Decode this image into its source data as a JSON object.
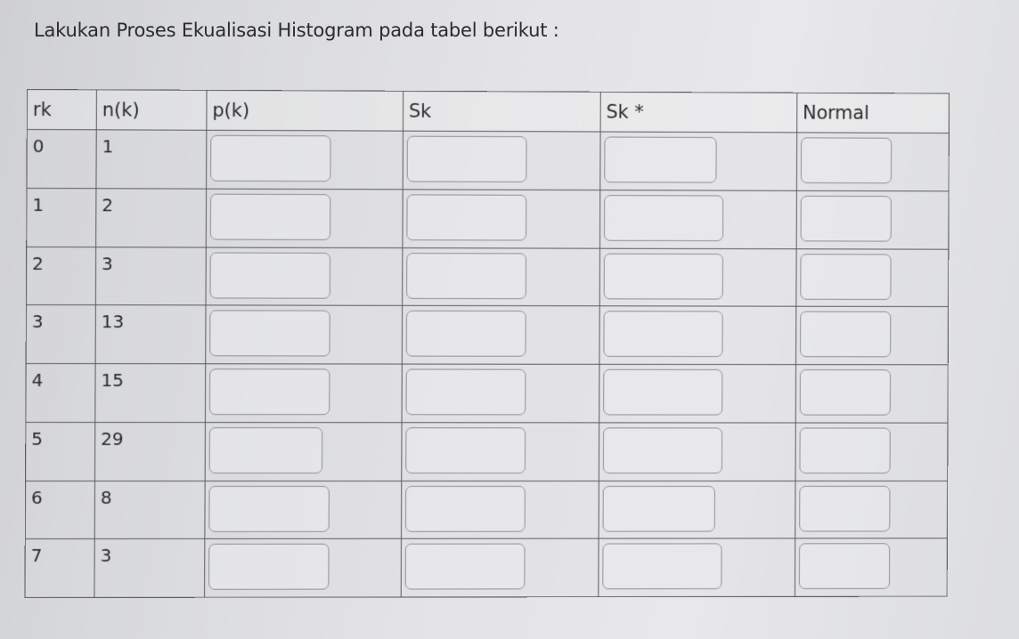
{
  "instruction": "Lakukan Proses Ekualisasi Histogram pada tabel berikut :",
  "table": {
    "headers": [
      "rk",
      "n(k)",
      "p(k)",
      "Sk",
      "Sk *",
      "Normal"
    ],
    "rows": [
      {
        "rk": "0",
        "nk": "1",
        "pk": "",
        "sk": "",
        "sk_star": "",
        "normal": ""
      },
      {
        "rk": "1",
        "nk": "2",
        "pk": "",
        "sk": "",
        "sk_star": "",
        "normal": ""
      },
      {
        "rk": "2",
        "nk": "3",
        "pk": "",
        "sk": "",
        "sk_star": "",
        "normal": ""
      },
      {
        "rk": "3",
        "nk": "13",
        "pk": "",
        "sk": "",
        "sk_star": "",
        "normal": ""
      },
      {
        "rk": "4",
        "nk": "15",
        "pk": "",
        "sk": "",
        "sk_star": "",
        "normal": ""
      },
      {
        "rk": "5",
        "nk": "29",
        "pk": "",
        "sk": "",
        "sk_star": "",
        "normal": ""
      },
      {
        "rk": "6",
        "nk": "8",
        "pk": "",
        "sk": "",
        "sk_star": "",
        "normal": ""
      },
      {
        "rk": "7",
        "nk": "3",
        "pk": "",
        "sk": "",
        "sk_star": "",
        "normal": ""
      }
    ]
  }
}
